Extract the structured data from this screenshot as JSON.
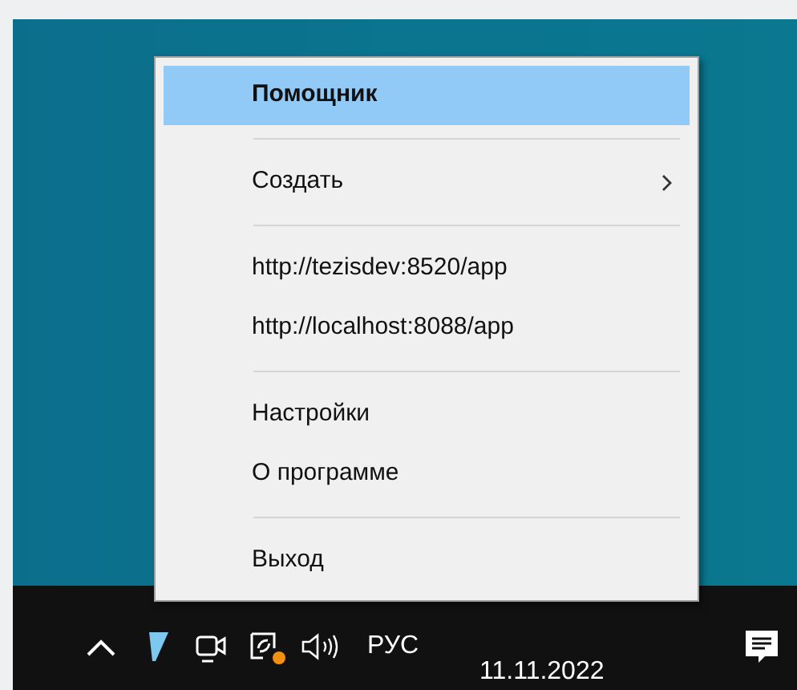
{
  "context_menu": {
    "items": [
      {
        "kind": "item",
        "label": "Помощник",
        "selected": true,
        "bold": true
      },
      {
        "kind": "separator"
      },
      {
        "kind": "submenu",
        "label": "Создать",
        "selected": false,
        "bold": false
      },
      {
        "kind": "separator"
      },
      {
        "kind": "item",
        "label": "http://tezisdev:8520/app",
        "selected": false,
        "bold": false
      },
      {
        "kind": "item",
        "label": "http://localhost:8088/app",
        "selected": false,
        "bold": false
      },
      {
        "kind": "separator"
      },
      {
        "kind": "item",
        "label": "Настройки",
        "selected": false,
        "bold": false
      },
      {
        "kind": "item",
        "label": "О программе",
        "selected": false,
        "bold": false
      },
      {
        "kind": "separator"
      },
      {
        "kind": "item",
        "label": "Выход",
        "selected": false,
        "bold": false
      }
    ]
  },
  "taskbar": {
    "language": "РУС",
    "date": "11.11.2022"
  }
}
